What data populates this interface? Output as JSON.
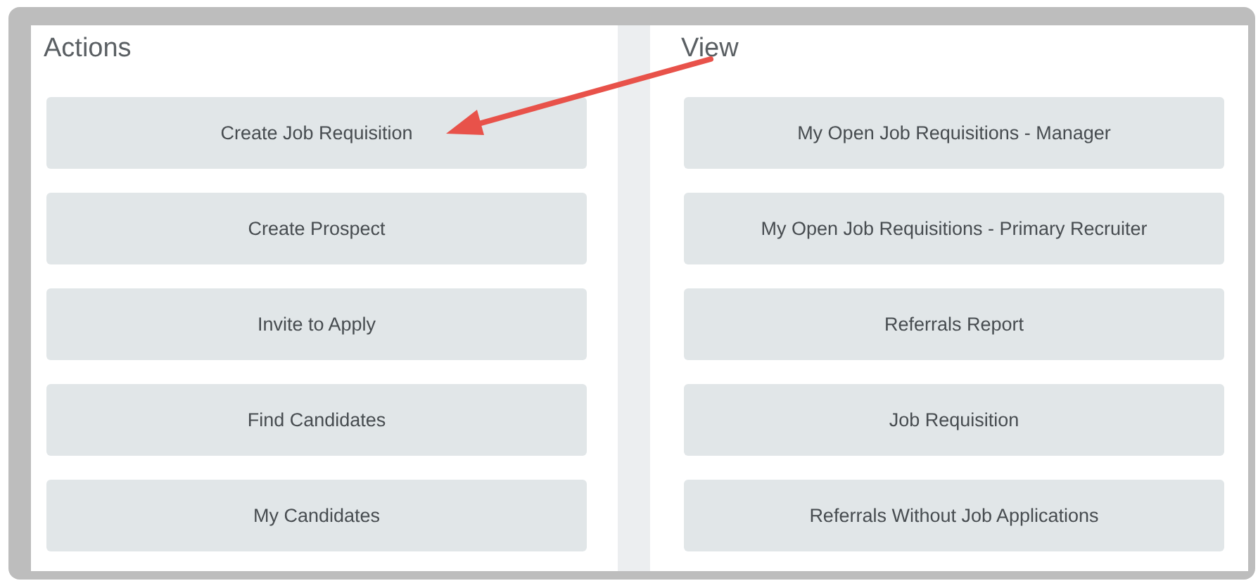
{
  "panels": [
    {
      "title": "Actions",
      "buttons": [
        "Create Job Requisition",
        "Create Prospect",
        "Invite to Apply",
        "Find Candidates",
        "My Candidates"
      ]
    },
    {
      "title": "View",
      "buttons": [
        "My Open Job Requisitions - Manager",
        "My Open Job Requisitions - Primary Recruiter",
        "Referrals Report",
        "Job Requisition",
        "Referrals Without Job Applications"
      ]
    }
  ]
}
